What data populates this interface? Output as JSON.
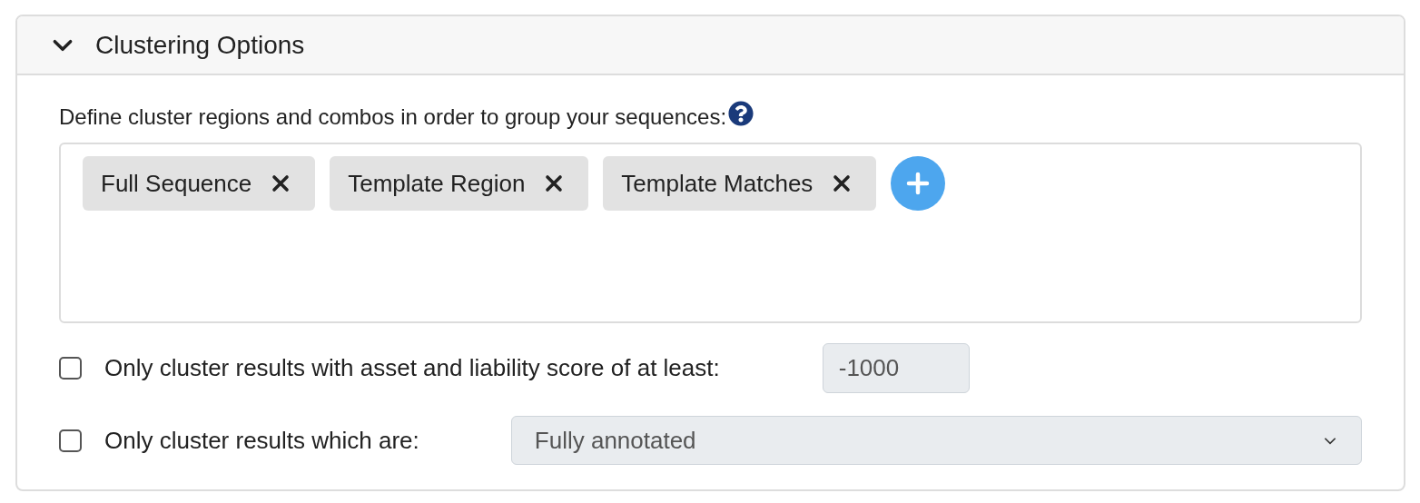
{
  "panel": {
    "title": "Clustering Options",
    "expanded": true
  },
  "regions": {
    "label": "Define cluster regions and combos in order to group your sequences:",
    "tags": [
      {
        "label": "Full Sequence"
      },
      {
        "label": "Template Region"
      },
      {
        "label": "Template Matches"
      }
    ]
  },
  "filters": [
    {
      "kind": "number",
      "label": "Only cluster results with asset and liability score of at least:",
      "checked": false,
      "value": "-1000",
      "disabled": true
    },
    {
      "kind": "select",
      "label": "Only cluster results which are:",
      "checked": false,
      "value": "Fully annotated",
      "disabled": true
    }
  ]
}
